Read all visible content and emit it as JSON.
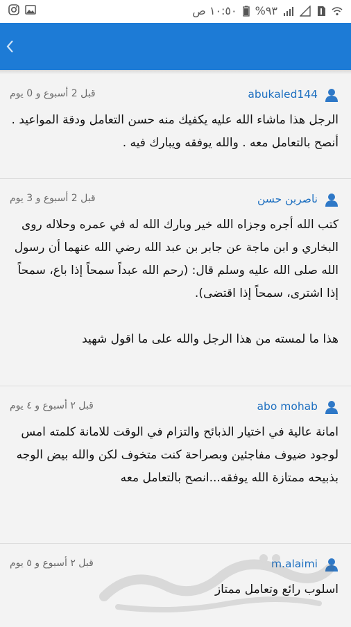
{
  "status_bar": {
    "time": "١٠:٥٠ ص",
    "battery": "%٩٣"
  },
  "app_bar": {
    "back_icon": "chevron-left-icon",
    "accent": "#1d7bd6"
  },
  "reviews": [
    {
      "username": "abukaled144",
      "time_ago": "قبل 2 أسبوع و 0 يوم",
      "body": "الرجل هذا ماشاء الله عليه يكفيك منه حسن التعامل ودقة المواعيد . أنصح بالتعامل معه . والله يوفقه ويبارك فيه ."
    },
    {
      "username": "ناصربن حسن",
      "time_ago": "قبل 2 أسبوع و 3 يوم",
      "body": "كتب الله أجره وجزاه الله خير وبارك الله له في عمره وحلاله روى البخاري و ابن ماجة عن جابر بن عبد الله رضي الله عنهما أن رسول الله صلى الله عليه وسلم قال: (رحم الله عبداً سمحاً إذا باع، سمحاً إذا اشترى، سمحاً إذا اقتضى).\n\nهذا ما لمسته من هذا الرجل والله على ما اقول شهيد"
    },
    {
      "username": "abo mohab",
      "time_ago": "قبل ٢ أسبوع و ٤ يوم",
      "body": "امانة عالية في اختيار الذبائح والتزام في الوقت للامانة كلمته امس لوجود ضيوف مفاجئين وبصراحة كنت متخوف لكن والله بيض الوجه بذبيحه ممتازة الله يوفقه...انصح بالتعامل معه"
    },
    {
      "username": "m.alaimi",
      "time_ago": "قبل ٢ أسبوع و ٥ يوم",
      "body": "اسلوب رائع وتعامل ممتاز"
    }
  ],
  "icons": {
    "user": "user-icon",
    "watermark": "haraj-logo-watermark"
  },
  "colors": {
    "username": "#1d6fc0",
    "user_icon": "#2e78c7"
  }
}
